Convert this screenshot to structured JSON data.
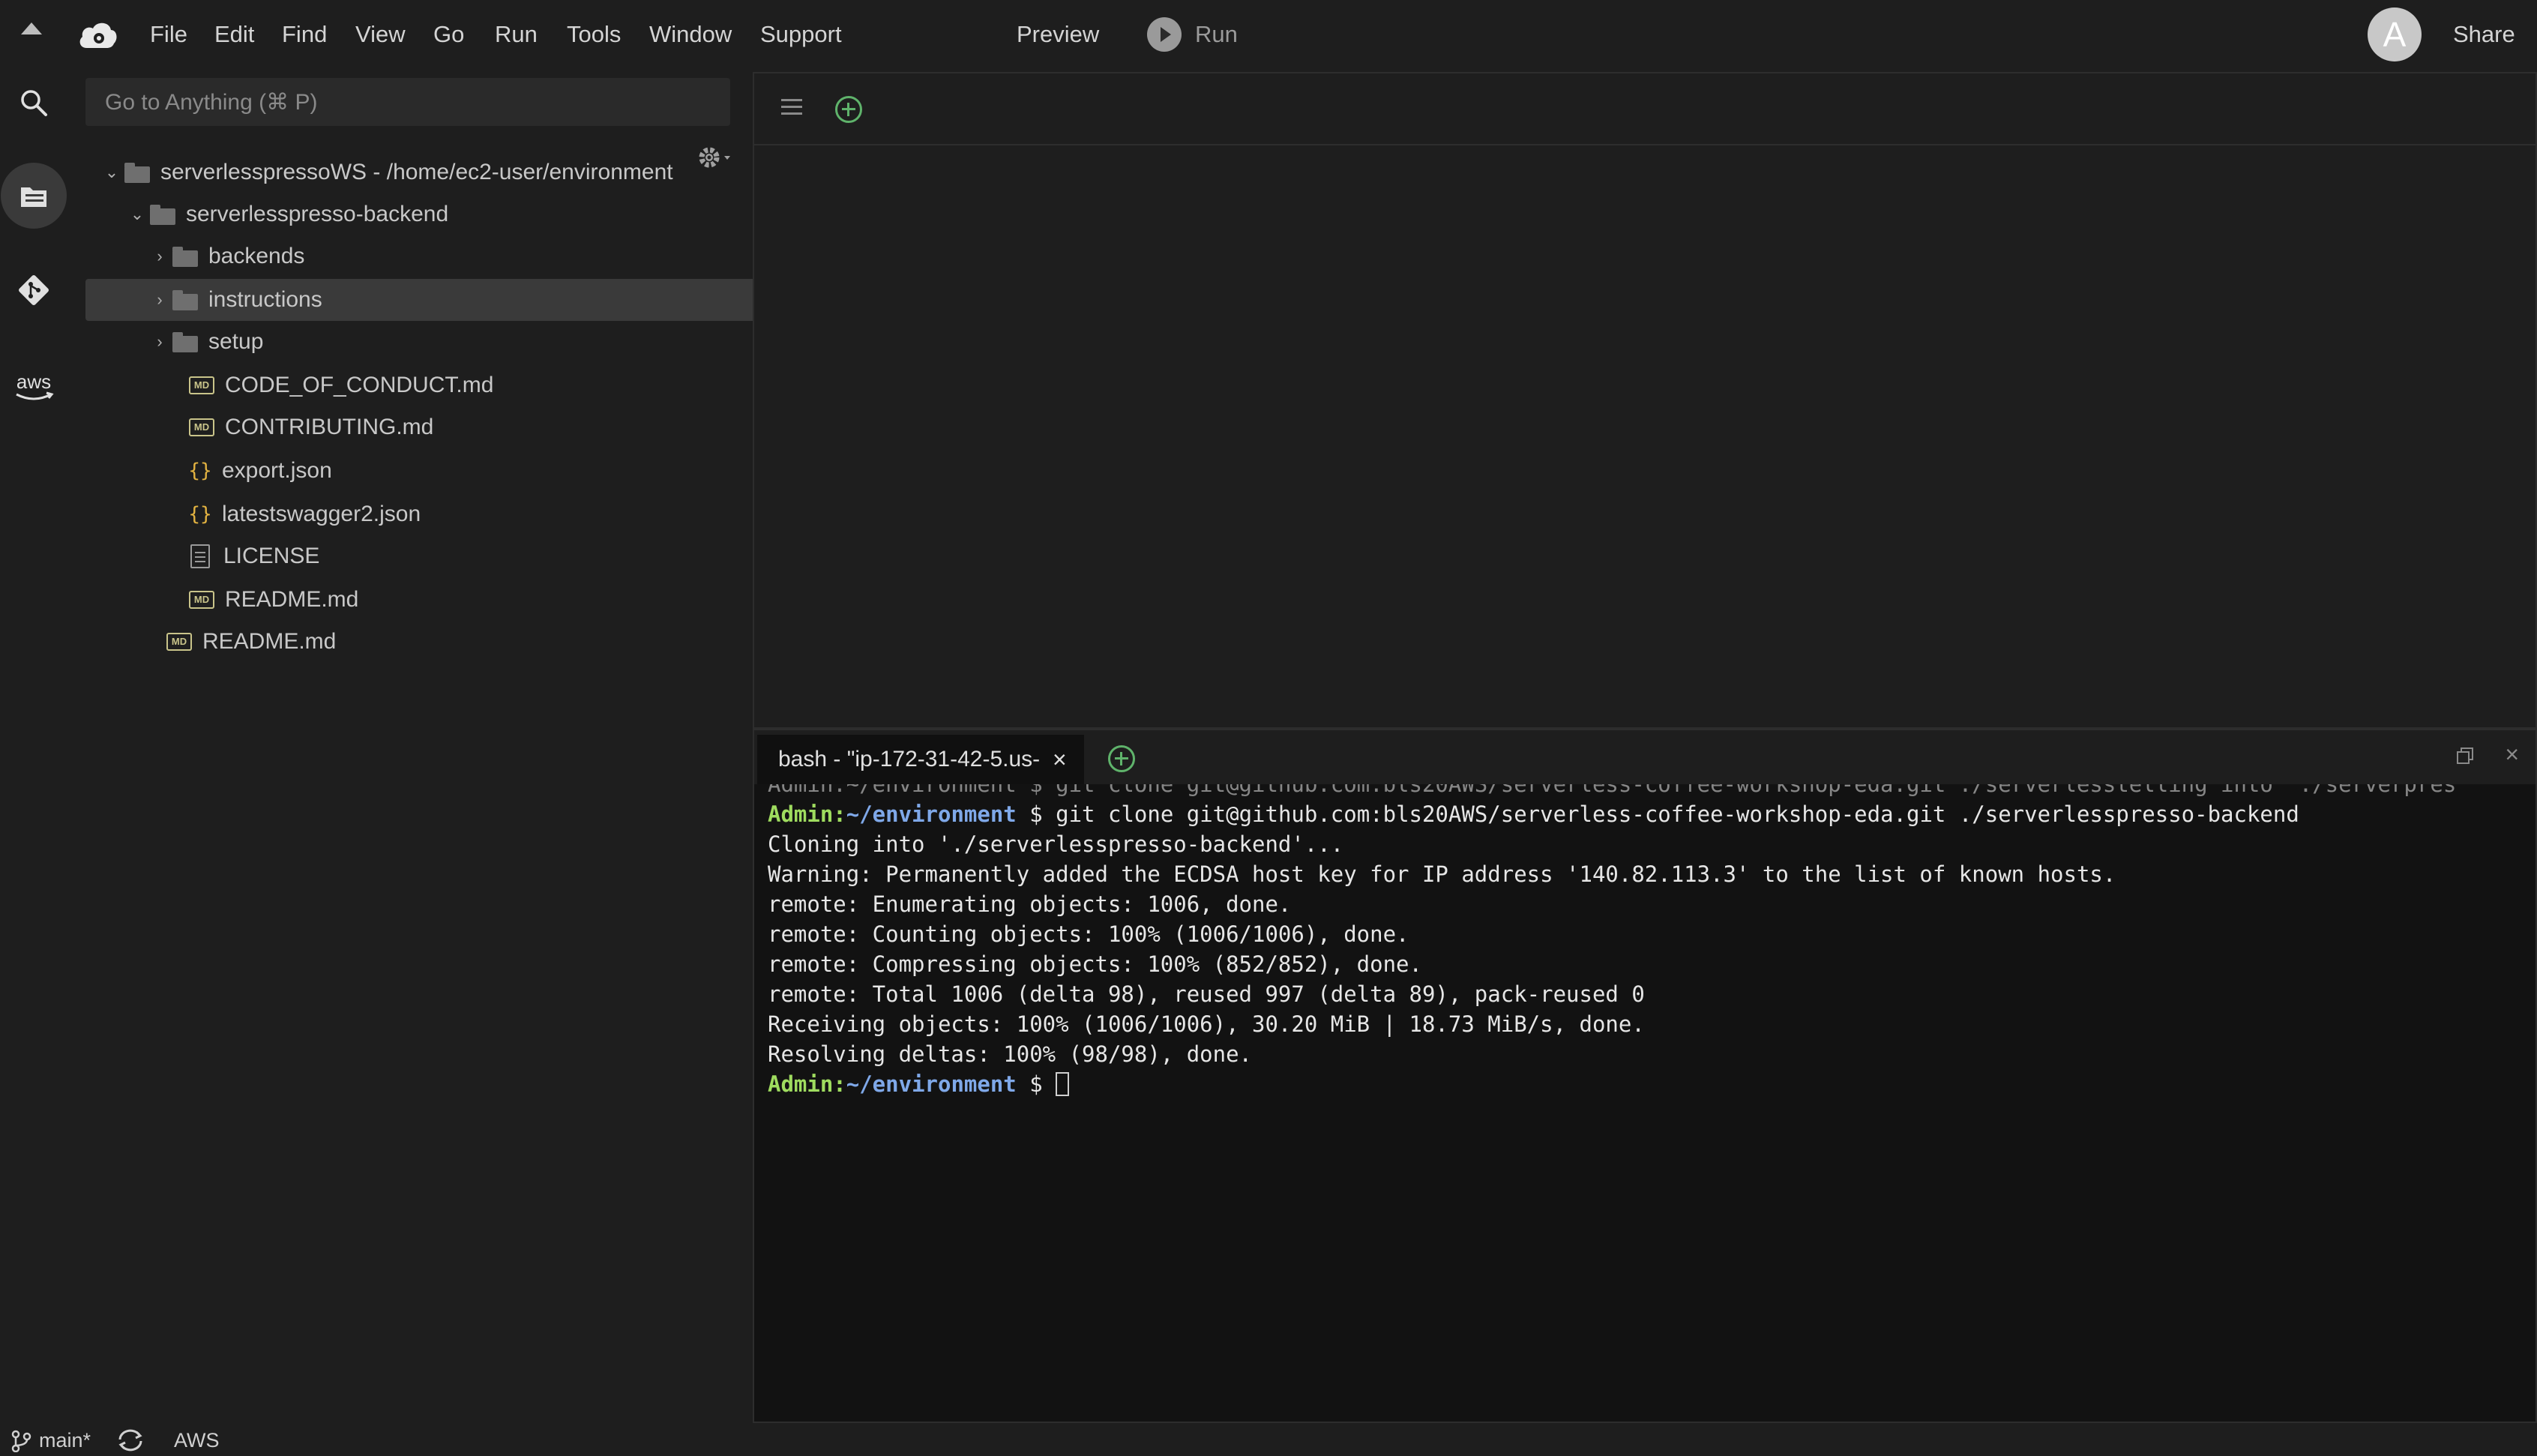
{
  "menubar": {
    "items": [
      "File",
      "Edit",
      "Find",
      "View",
      "Go",
      "Run",
      "Tools",
      "Window",
      "Support"
    ],
    "preview_label": "Preview",
    "run_label": "Run",
    "avatar_letter": "A",
    "share_label": "Share"
  },
  "activity": {
    "icons": [
      "search-icon",
      "files-icon",
      "git-icon",
      "aws-icon"
    ],
    "aws_label": "aws"
  },
  "sidebar": {
    "search_placeholder": "Go to Anything (⌘ P)",
    "tree": [
      {
        "label": "serverlesspressoWS - /home/ec2-user/environment",
        "type": "folder",
        "expanded": true
      },
      {
        "label": "serverlesspresso-backend",
        "type": "folder",
        "expanded": true
      },
      {
        "label": "backends",
        "type": "folder",
        "expanded": false
      },
      {
        "label": "instructions",
        "type": "folder",
        "expanded": false,
        "selected": true
      },
      {
        "label": "setup",
        "type": "folder",
        "expanded": false
      },
      {
        "label": "CODE_OF_CONDUCT.md",
        "type": "md"
      },
      {
        "label": "CONTRIBUTING.md",
        "type": "md"
      },
      {
        "label": "export.json",
        "type": "json"
      },
      {
        "label": "latestswagger2.json",
        "type": "json"
      },
      {
        "label": "LICENSE",
        "type": "text"
      },
      {
        "label": "README.md",
        "type": "md"
      },
      {
        "label": "README.md",
        "type": "md"
      }
    ]
  },
  "terminal": {
    "tab_label": "bash - \"ip-172-31-42-5.us-",
    "prompt_user": "Admin:",
    "prompt_path": "~/environment",
    "prompt_symbol": " $ ",
    "cut_line": "Admin:~/environment $ git clone git@github.com:bls20AWS/serverless-coffee-workshop-eda.git ./serverlesstelling into './serverpres",
    "command": "git clone git@github.com:bls20AWS/serverless-coffee-workshop-eda.git ./serverlesspresso-backend",
    "output": [
      "Cloning into './serverlesspresso-backend'...",
      "Warning: Permanently added the ECDSA host key for IP address '140.82.113.3' to the list of known hosts.",
      "remote: Enumerating objects: 1006, done.",
      "remote: Counting objects: 100% (1006/1006), done.",
      "remote: Compressing objects: 100% (852/852), done.",
      "remote: Total 1006 (delta 98), reused 997 (delta 89), pack-reused 0",
      "Receiving objects: 100% (1006/1006), 30.20 MiB | 18.73 MiB/s, done.",
      "Resolving deltas: 100% (98/98), done."
    ]
  },
  "statusbar": {
    "branch": "main*",
    "aws_label": "AWS"
  },
  "colors": {
    "background": "#1e1e1e",
    "terminal_bg": "#121212",
    "prompt_user": "#9fdc5f",
    "prompt_path": "#7fa8e8",
    "accent_green": "#5fb36b",
    "md_badge": "#c9c48a",
    "json_badge": "#e3b341"
  }
}
